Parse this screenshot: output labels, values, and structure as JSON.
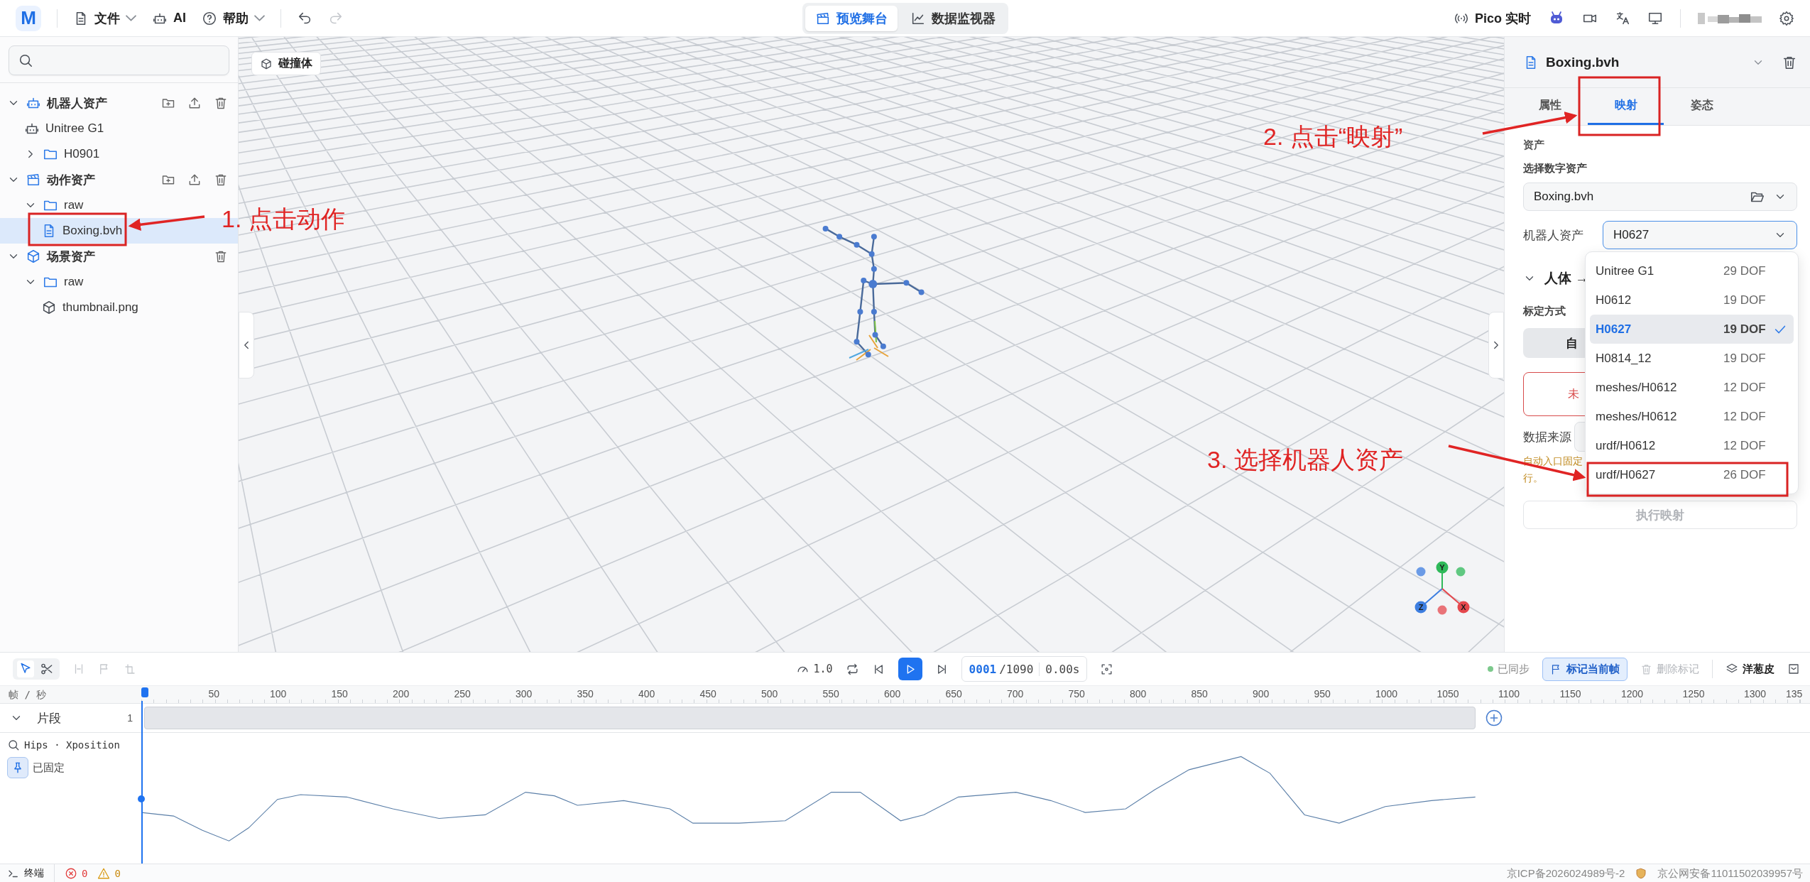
{
  "top_bar": {
    "logo": "M",
    "menus": [
      {
        "label": "文件",
        "kind": "file",
        "dropdown": true
      },
      {
        "label": "AI",
        "kind": "ai",
        "dropdown": false
      },
      {
        "label": "帮助",
        "kind": "help",
        "dropdown": true
      }
    ],
    "undo": {
      "disabled": false
    },
    "redo": {
      "disabled": true
    },
    "views": [
      {
        "label": "预览舞台",
        "kind": "stage",
        "selected": true
      },
      {
        "label": "数据监视器",
        "kind": "monitor",
        "selected": false
      }
    ],
    "live": "Pico 实时"
  },
  "sidebar": {
    "tree": [
      {
        "label": "机器人资产",
        "kind": "robots",
        "expanded": true,
        "selected": false,
        "can_add": true,
        "can_upload": true,
        "children": [
          {
            "label": "Unitree G1",
            "kind": "robot",
            "selected": false
          },
          {
            "label": "H0901",
            "kind": "folder",
            "expanded": false,
            "selected": false
          }
        ]
      },
      {
        "label": "动作资产",
        "kind": "motions",
        "expanded": true,
        "selected": false,
        "can_add": true,
        "can_upload": true,
        "children": [
          {
            "label": "raw",
            "kind": "folder",
            "expanded": true,
            "selected": false,
            "children": [
              {
                "label": "Boxing.bvh",
                "kind": "file",
                "selected": true
              }
            ]
          }
        ]
      },
      {
        "label": "场景资产",
        "kind": "scenes",
        "expanded": true,
        "selected": false,
        "can_add": false,
        "can_upload": false,
        "children": [
          {
            "label": "raw",
            "kind": "folder",
            "expanded": true,
            "selected": false,
            "children": [
              {
                "label": "thumbnail.png",
                "kind": "model",
                "selected": false
              }
            ]
          }
        ]
      }
    ]
  },
  "viewport": {
    "collider_button": "碰撞体",
    "gizmo": [
      {
        "label": "Y",
        "color": "#2fb95a"
      },
      {
        "label": "Z",
        "color": "#3d7ee0"
      },
      {
        "label": "X",
        "color": "#e5484d"
      }
    ]
  },
  "right_panel": {
    "title": "Boxing.bvh",
    "tabs": [
      {
        "label": "属性",
        "selected": false
      },
      {
        "label": "映射",
        "selected": true
      },
      {
        "label": "姿态",
        "selected": false
      }
    ],
    "section": "资产",
    "asset_label": "选择数字资产",
    "asset_value": "Boxing.bvh",
    "robot_label": "机器人资产",
    "robot_value": "H0627",
    "dropdown": {
      "open": true,
      "options": [
        {
          "name": "Unitree G1",
          "dof": "29 DOF",
          "selected": false
        },
        {
          "name": "H0612",
          "dof": "19 DOF",
          "selected": false
        },
        {
          "name": "H0627",
          "dof": "19 DOF",
          "selected": true
        },
        {
          "name": "H0814_12",
          "dof": "19 DOF",
          "selected": false
        },
        {
          "name": "meshes/H0612",
          "dof": "12 DOF",
          "selected": false
        },
        {
          "name": "meshes/H0612",
          "dof": "12 DOF",
          "selected": false
        },
        {
          "name": "urdf/H0612",
          "dof": "12 DOF",
          "selected": false
        },
        {
          "name": "urdf/H0627",
          "dof": "26 DOF",
          "selected": false
        }
      ]
    },
    "mapping_title": "人体 →",
    "calib_label": "标定方式",
    "auto_button": "自",
    "status_text": "未",
    "source_label": "数据来源",
    "warning_lines": [
      "自动入口固定",
      "行。"
    ],
    "run_button": {
      "label": "执行映射",
      "disabled": true
    }
  },
  "timeline": {
    "tools": [
      {
        "kind": "select",
        "selected": true
      },
      {
        "kind": "cut",
        "selected": false
      }
    ],
    "edit_tools": [
      {
        "kind": "split",
        "disabled": true
      },
      {
        "kind": "flag",
        "disabled": true
      },
      {
        "kind": "trim",
        "disabled": true
      }
    ],
    "speed": "1.0",
    "frame": "0001",
    "total": "/1090",
    "time": "0.00s",
    "sync": "已同步",
    "mark_button": "标记当前帧",
    "delete_mark": {
      "label": "删除标记",
      "disabled": true
    },
    "onion": "洋葱皮",
    "ruler_label": "帧 / 秒",
    "ticks": [
      "50",
      "100",
      "150",
      "200",
      "250",
      "300",
      "350",
      "400",
      "450",
      "500",
      "550",
      "600",
      "650",
      "700",
      "750",
      "800",
      "850",
      "900",
      "950",
      "1000",
      "1050",
      "1100",
      "1150",
      "1200",
      "1250",
      "1300",
      "135"
    ],
    "track": {
      "label": "片段",
      "expanded": true,
      "index": "1"
    },
    "curve": {
      "label": "Hips · Xposition",
      "pin": {
        "label": "已固定",
        "on": true
      }
    }
  },
  "status_bar": {
    "terminal": "终端",
    "errors": "0",
    "warnings": "0",
    "icp": "京ICP备2026024989号-2",
    "police": "京公网安备11011502039957号"
  },
  "annotations": [
    {
      "label": "1. 点击动作"
    },
    {
      "label": "2. 点击“映射”"
    },
    {
      "label": "3. 选择机器人资产"
    }
  ]
}
